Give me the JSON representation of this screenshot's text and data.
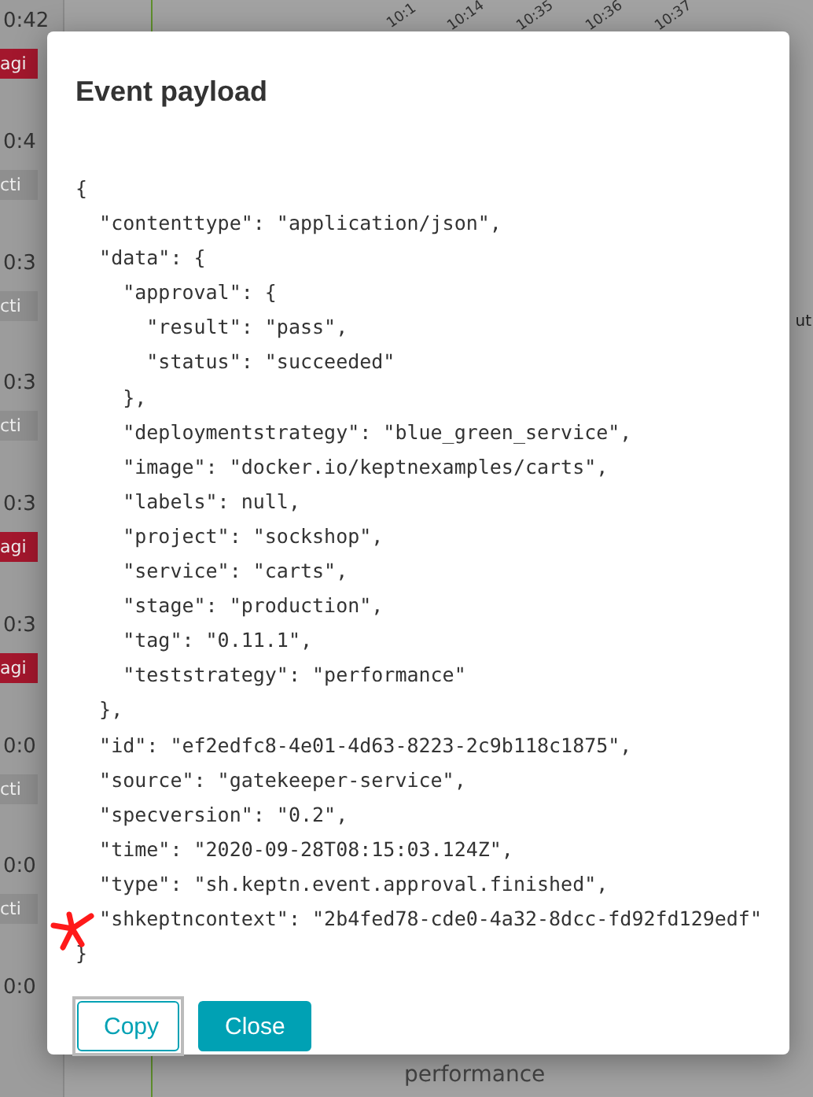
{
  "background": {
    "timeline_ticks": [
      "10:1",
      "10:14",
      "10:35",
      "10:36",
      "10:37"
    ],
    "events": [
      {
        "time": "0:42",
        "tag": "agi",
        "color": "#a3172d"
      },
      {
        "time": "0:4",
        "tag": "cti",
        "color": "#8f8f8f"
      },
      {
        "time": "0:3",
        "tag": "cti",
        "color": "#8f8f8f"
      },
      {
        "time": "0:3",
        "tag": "cti",
        "color": "#8f8f8f"
      },
      {
        "time": "0:3",
        "tag": "agi",
        "color": "#a3172d"
      },
      {
        "time": "0:3",
        "tag": "agi",
        "color": "#a3172d"
      },
      {
        "time": "0:0",
        "tag": "cti",
        "color": "#8f8f8f"
      },
      {
        "time": "0:0",
        "tag": "cti",
        "color": "#8f8f8f"
      },
      {
        "time": "0:0"
      }
    ],
    "side_text": "ut",
    "detail_value": "performance"
  },
  "dialog": {
    "title": "Event payload",
    "payload_lines": [
      "{",
      "  \"contenttype\": \"application/json\",",
      "  \"data\": {",
      "    \"approval\": {",
      "      \"result\": \"pass\",",
      "      \"status\": \"succeeded\"",
      "    },",
      "    \"deploymentstrategy\": \"blue_green_service\",",
      "    \"image\": \"docker.io/keptnexamples/carts\",",
      "    \"labels\": null,",
      "    \"project\": \"sockshop\",",
      "    \"service\": \"carts\",",
      "    \"stage\": \"production\",",
      "    \"tag\": \"0.11.1\",",
      "    \"teststrategy\": \"performance\"",
      "  },",
      "  \"id\": \"ef2edfc8-4e01-4d63-8223-2c9b118c1875\",",
      "  \"source\": \"gatekeeper-service\",",
      "  \"specversion\": \"0.2\",",
      "  \"time\": \"2020-09-28T08:15:03.124Z\",",
      "  \"type\": \"sh.keptn.event.approval.finished\",",
      "  \"shkeptncontext\": \"2b4fed78-cde0-4a32-8dcc-fd92fd129edf\"",
      "}"
    ],
    "buttons": [
      {
        "label": "Copy",
        "kind": "outline",
        "focused": true
      },
      {
        "label": "Close",
        "kind": "primary",
        "focused": false
      }
    ]
  }
}
